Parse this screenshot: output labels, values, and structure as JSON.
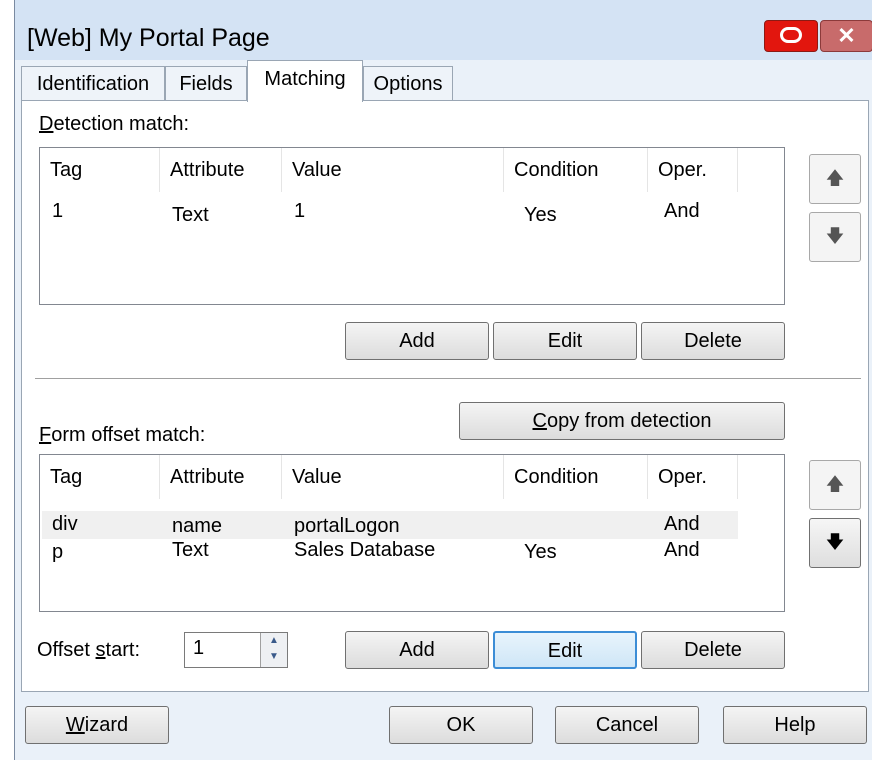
{
  "window": {
    "title": "[Web] My Portal Page"
  },
  "tabs": [
    {
      "label": "Identification"
    },
    {
      "label": "Fields"
    },
    {
      "label": "Matching"
    },
    {
      "label": "Options"
    }
  ],
  "detection": {
    "label_underlined": "D",
    "label_rest": "etection match:",
    "columns": [
      "Tag",
      "Attribute",
      "Value",
      "Condition",
      "Oper."
    ],
    "rows": [
      {
        "tag": "1",
        "attribute": "Text",
        "value": "1",
        "condition": "Yes",
        "oper": "And"
      }
    ],
    "buttons": {
      "add": "Add",
      "edit": "Edit",
      "delete": "Delete"
    },
    "up_icon": "arrow-up-icon",
    "down_icon": "arrow-down-icon"
  },
  "form_offset": {
    "label_underlined": "F",
    "label_rest": "orm offset match:",
    "copy_button_underlined": "C",
    "copy_button_rest": "opy from detection",
    "columns": [
      "Tag",
      "Attribute",
      "Value",
      "Condition",
      "Oper."
    ],
    "rows": [
      {
        "tag": "div",
        "attribute": "name",
        "value": "portalLogon",
        "condition": "",
        "oper": "And"
      },
      {
        "tag": "p",
        "attribute": "Text",
        "value": "Sales Database",
        "condition": "Yes",
        "oper": "And"
      }
    ],
    "buttons": {
      "add": "Add",
      "edit": "Edit",
      "delete": "Delete"
    }
  },
  "offset_start": {
    "label_pre": "Offset ",
    "label_underlined": "s",
    "label_rest": "tart:",
    "value": "1"
  },
  "footer": {
    "wizard_underlined": "W",
    "wizard_rest": "izard",
    "ok": "OK",
    "cancel": "Cancel",
    "help": "Help"
  },
  "colors": {
    "close_button": "#e2160e",
    "focus_border": "#3c8dd6",
    "background": "#eaf1f9"
  }
}
